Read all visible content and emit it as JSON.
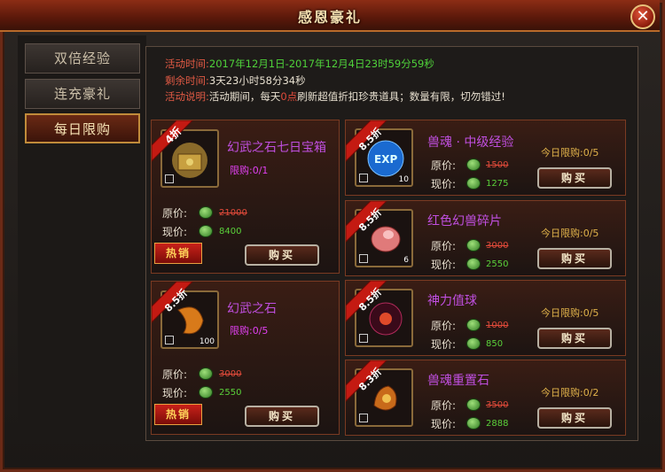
{
  "window": {
    "title": "感恩豪礼",
    "close_symbol": "✕"
  },
  "tabs": [
    {
      "label": "双倍经验",
      "active": false
    },
    {
      "label": "连充豪礼",
      "active": false
    },
    {
      "label": "每日限购",
      "active": true
    }
  ],
  "info": {
    "time_label": "活动时间:",
    "time_value": "2017年12月1日-2017年12月4日23时59分59秒",
    "remain_label": "剩余时间:",
    "remain_value": "3天23小时58分34秒",
    "desc_label": "活动说明:",
    "desc_pre": "活动期间，每天",
    "desc_highlight": "0点",
    "desc_post": "刷新超值折扣珍贵道具；数量有限，切勿错过!"
  },
  "labels": {
    "orig": "原价:",
    "now": "现价:",
    "buy": "购买",
    "hot": "热销"
  },
  "items": [
    {
      "name": "幻武之石七日宝箱",
      "discount": "4折",
      "limit": "限购:0/1",
      "orig": "21000",
      "now": "8400",
      "count": "",
      "hot": true,
      "icon": "treasure-chest-icon"
    },
    {
      "name": "幻武之石",
      "discount": "8.5折",
      "limit": "限购:0/5",
      "orig": "3000",
      "now": "2550",
      "count": "100",
      "hot": true,
      "icon": "orange-stone-icon"
    },
    {
      "name": "兽魂 · 中级经验",
      "discount": "8.5折",
      "limit": "今日限购:0/5",
      "orig": "1500",
      "now": "1275",
      "count": "10",
      "icon": "exp-orb-icon"
    },
    {
      "name": "红色幻兽碎片",
      "discount": "8.5折",
      "limit": "今日限购:0/5",
      "orig": "3000",
      "now": "2550",
      "count": "6",
      "icon": "red-shard-icon"
    },
    {
      "name": "神力值球",
      "discount": "8.5折",
      "limit": "今日限购:0/5",
      "orig": "1000",
      "now": "850",
      "count": "",
      "icon": "power-orb-icon"
    },
    {
      "name": "兽魂重置石",
      "discount": "8.3折",
      "limit": "今日限购:0/2",
      "orig": "3500",
      "now": "2888",
      "count": "",
      "icon": "reset-stone-icon"
    }
  ],
  "colors": {
    "accent": "#8c2d15",
    "item_name": "#c04fe0",
    "limit": "#e0b24a",
    "orig_price": "#e04a3a",
    "now_price": "#5ad13a"
  }
}
